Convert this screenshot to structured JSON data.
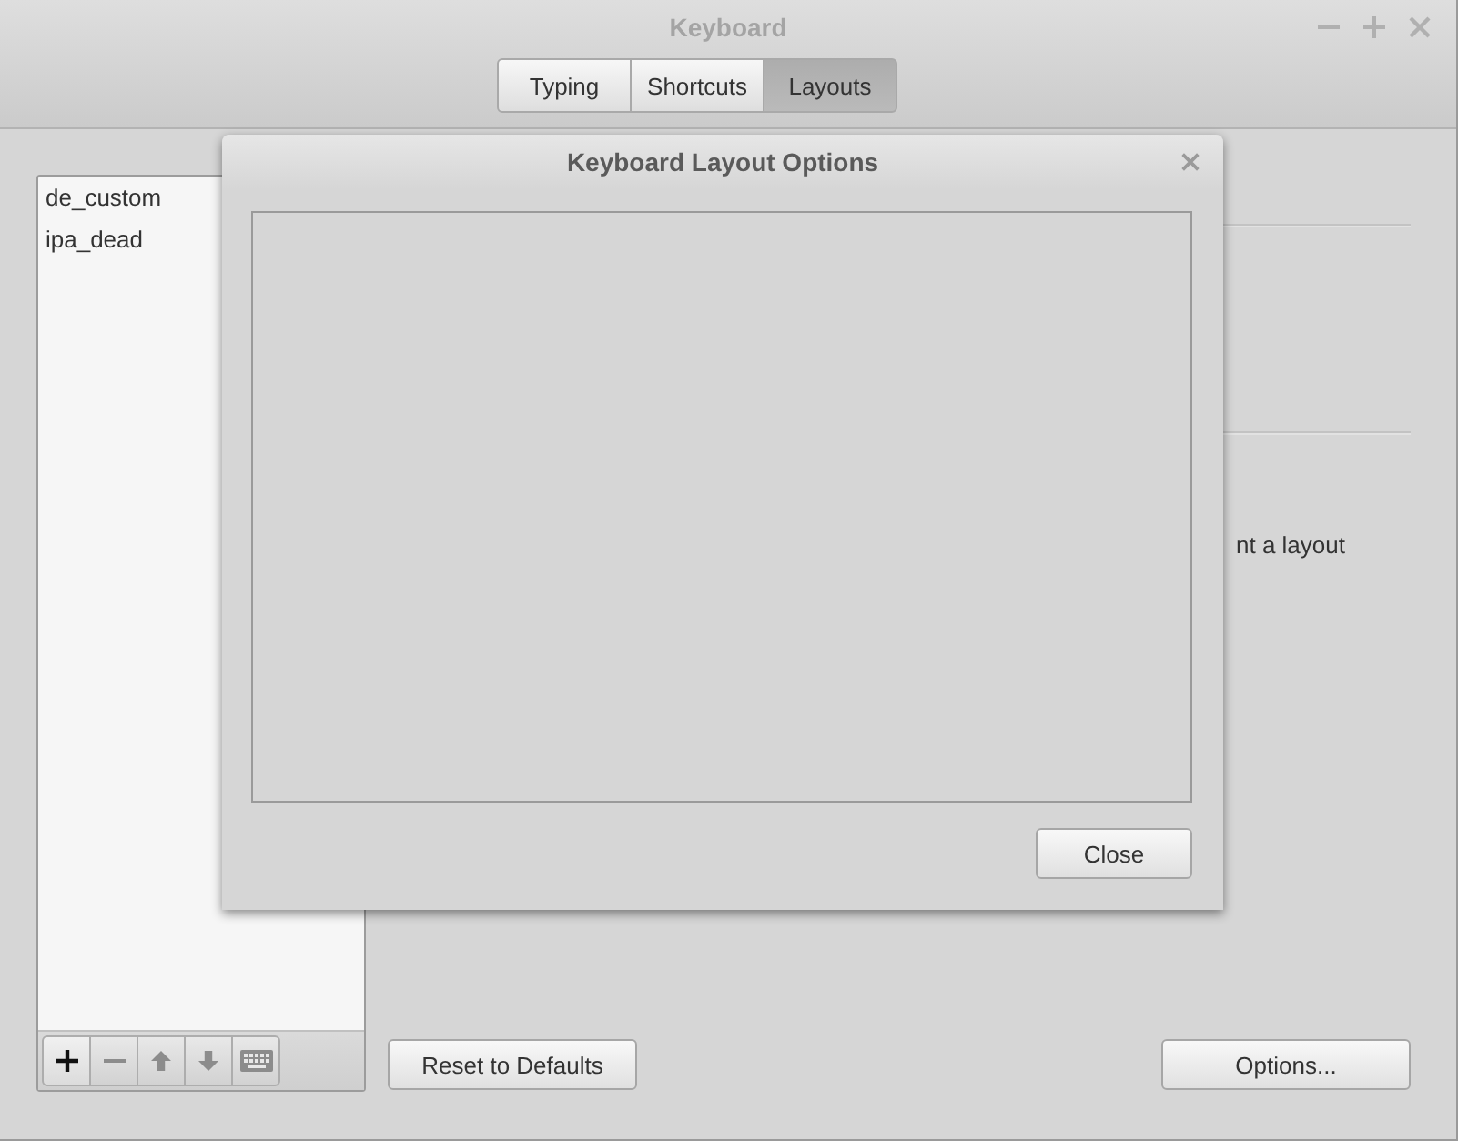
{
  "window": {
    "title": "Keyboard"
  },
  "tabs": [
    {
      "label": "Typing",
      "selected": false
    },
    {
      "label": "Shortcuts",
      "selected": false
    },
    {
      "label": "Layouts",
      "selected": true
    }
  ],
  "layouts": {
    "items": [
      {
        "label": "de_custom",
        "selected": false
      },
      {
        "label": "ipa_dead",
        "selected": false
      }
    ],
    "toolbar": [
      {
        "kind": "add",
        "disabled": false
      },
      {
        "kind": "remove",
        "disabled": true
      },
      {
        "kind": "move_up",
        "disabled": true
      },
      {
        "kind": "move_down",
        "disabled": true
      },
      {
        "kind": "show_layout",
        "disabled": true
      }
    ]
  },
  "panel": {
    "partial_text": "nt a layout",
    "buttons": [
      "Reset to Defaults",
      "Options..."
    ]
  },
  "dialog": {
    "title": "Keyboard Layout Options",
    "close_button": "Close"
  }
}
